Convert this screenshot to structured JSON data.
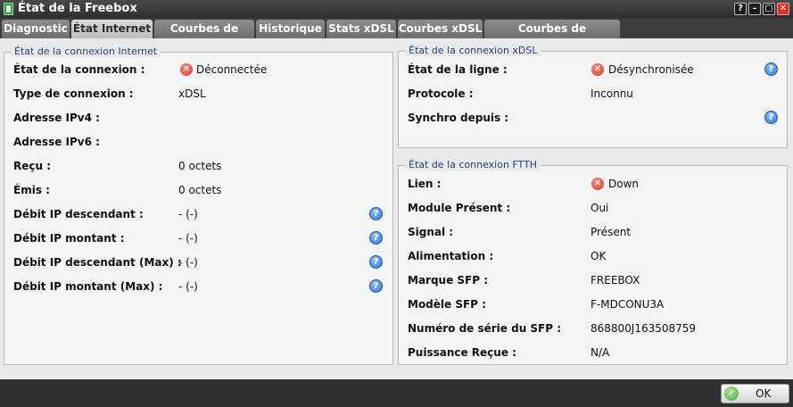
{
  "window": {
    "title": "État de la Freebox",
    "controls": {
      "help": "?",
      "minimize": "–",
      "maximize": "▢",
      "close": "✕"
    }
  },
  "tabs": [
    {
      "label": "Diagnostic",
      "active": false
    },
    {
      "label": "État Internet",
      "active": true
    },
    {
      "label": "Courbes de Débit",
      "active": false
    },
    {
      "label": "Historique",
      "active": false
    },
    {
      "label": "Stats xDSL",
      "active": false
    },
    {
      "label": "Courbes xDSL",
      "active": false
    },
    {
      "label": "Courbes de température",
      "active": false
    }
  ],
  "internet": {
    "legend": "État de la connexion Internet",
    "rows": [
      {
        "label": "État de la connexion :",
        "value": "Déconnectée",
        "status": "error"
      },
      {
        "label": "Type de connexion :",
        "value": "xDSL"
      },
      {
        "label": "Adresse IPv4 :",
        "value": ""
      },
      {
        "label": "Adresse IPv6 :",
        "value": ""
      },
      {
        "label": "Reçu :",
        "value": "0 octets"
      },
      {
        "label": "Émis :",
        "value": "0 octets"
      },
      {
        "label": "Débit IP descendant :",
        "value": "- (-)",
        "help": true
      },
      {
        "label": "Débit IP montant :",
        "value": "- (-)",
        "help": true
      },
      {
        "label": "Débit IP descendant (Max) :",
        "value": "- (-)",
        "help": true
      },
      {
        "label": "Débit IP montant (Max) :",
        "value": "- (-)",
        "help": true
      }
    ]
  },
  "xdsl": {
    "legend": "État de la connexion xDSL",
    "rows": [
      {
        "label": "État de la ligne :",
        "value": "Désynchronisée",
        "status": "error",
        "help": true
      },
      {
        "label": "Protocole :",
        "value": "Inconnu"
      },
      {
        "label": "Synchro depuis :",
        "value": "",
        "help": true
      }
    ]
  },
  "ftth": {
    "legend": "État de la connexion FTTH",
    "rows": [
      {
        "label": "Lien :",
        "value": "Down",
        "status": "error"
      },
      {
        "label": "Module Présent :",
        "value": "Oui"
      },
      {
        "label": "Signal :",
        "value": "Présent"
      },
      {
        "label": "Alimentation :",
        "value": "OK"
      },
      {
        "label": "Marque SFP :",
        "value": "FREEBOX"
      },
      {
        "label": "Modèle SFP :",
        "value": "F-MDCONU3A"
      },
      {
        "label": "Numéro de série du SFP :",
        "value": "868800J163508759"
      },
      {
        "label": "Puissance Reçue :",
        "value": "N/A"
      }
    ]
  },
  "icons": {
    "error": "✕",
    "help": "?",
    "ok": "✓"
  },
  "footer": {
    "ok_label": "OK"
  },
  "colors": {
    "error": "#d6392c",
    "help": "#2f74c8",
    "ok": "#4aa93a",
    "legend_text": "#2a3f7a"
  }
}
